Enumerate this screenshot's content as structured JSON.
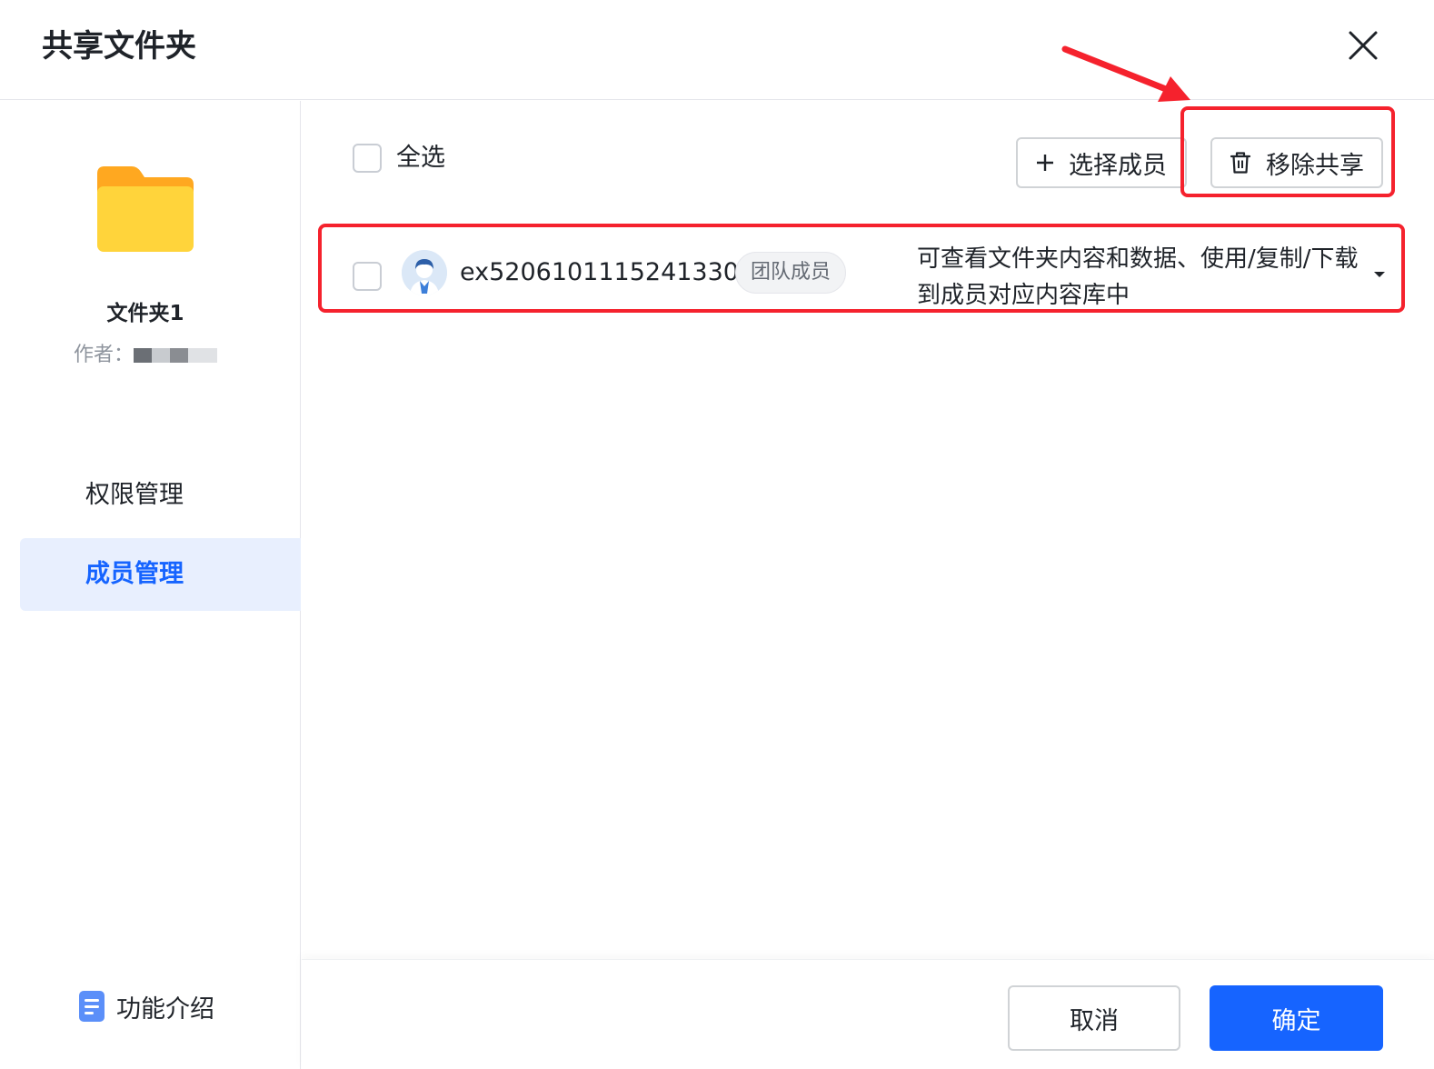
{
  "dialog": {
    "title": "共享文件夹",
    "close_icon": "close-icon"
  },
  "sidebar": {
    "folder_icon": "folder-icon",
    "folder_name": "文件夹1",
    "author_label": "作者：",
    "author_value_redacted": true,
    "nav": [
      {
        "label": "权限管理",
        "active": false
      },
      {
        "label": "成员管理",
        "active": true
      }
    ],
    "feature_intro": {
      "icon": "document-icon",
      "label": "功能介绍"
    }
  },
  "main": {
    "select_all_label": "全选",
    "add_member_button": {
      "icon": "plus-icon",
      "label": "选择成员"
    },
    "remove_share_button": {
      "icon": "trash-icon",
      "label": "移除共享"
    },
    "members": [
      {
        "id": "ex52061011152413302",
        "badge": "团队成员",
        "permission": "可查看文件夹内容和数据、使用/复制/下载到成员对应内容库中",
        "checked": false
      }
    ]
  },
  "footer": {
    "cancel_label": "取消",
    "ok_label": "确定"
  },
  "colors": {
    "primary": "#1664ff",
    "annotation_red": "#f5222d",
    "nav_active_bg": "#e8effe",
    "folder_yellow": "#ffd43b",
    "folder_orange": "#ffa820"
  }
}
